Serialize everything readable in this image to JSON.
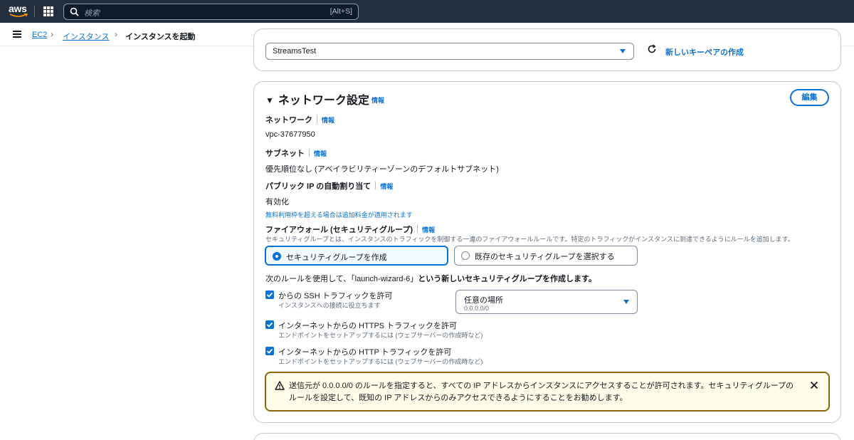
{
  "topbar": {
    "logo_text": "aws",
    "search_placeholder": "検索",
    "search_shortcut": "[Alt+S]"
  },
  "breadcrumb": {
    "items": [
      "EC2",
      "インスタンス",
      "インスタンスを起動"
    ]
  },
  "keypair": {
    "selected": "StreamsTest",
    "new_link": "新しいキーペアの作成"
  },
  "network": {
    "title": "ネットワーク設定",
    "info": "情報",
    "edit_button": "編集",
    "network_label": "ネットワーク",
    "network_value": "vpc-37677950",
    "subnet_label": "サブネット",
    "subnet_value": "優先順位なし (アベイラビリティーゾーンのデフォルトサブネット)",
    "public_ip_label": "パブリック IP の自動割り当て",
    "public_ip_value": "有効化",
    "charges_link": "無料利用枠を超える場合は追加料金が適用されます",
    "firewall_label": "ファイアウォール (セキュリティグループ)",
    "firewall_desc": "セキュリティグループとは、インスタンスのトラフィックを制御する一連のファイアウォールルールです。特定のトラフィックがインスタンスに到達できるようにルールを追加します。",
    "radio_create": "セキュリティグループを作成",
    "radio_existing": "既存のセキュリティグループを選択する",
    "rule_prefix": "次のルールを使用して、「launch-wizard-6」",
    "rule_suffix": "という新しいセキュリティグループを作成します。",
    "ssh_label": "からの SSH トラフィックを許可",
    "ssh_sub": "インスタンスへの接続に役立ちます",
    "source_value": "任意の場所",
    "source_cidr": "0.0.0.0/0",
    "https_label": "インターネットからの HTTPS トラフィックを許可",
    "https_sub": "エンドポイントをセットアップするには (ウェブサーバーの作成時など)",
    "http_label": "インターネットからの HTTP トラフィックを許可",
    "http_sub": "エンドポイントをセットアップするには (ウェブサーバーの作成時など)",
    "warning": "送信元が 0.0.0.0/0 のルールを指定すると、すべての IP アドレスからインスタンスにアクセスすることが許可されます。セキュリティグループのルールを設定して、既知の IP アドレスからのみアクセスできるようにすることをお勧めします。"
  },
  "colors": {
    "topbar": "#232f3e",
    "link": "#0972d3",
    "warning_border": "#8d6605",
    "warning_bg": "#fffce9"
  }
}
